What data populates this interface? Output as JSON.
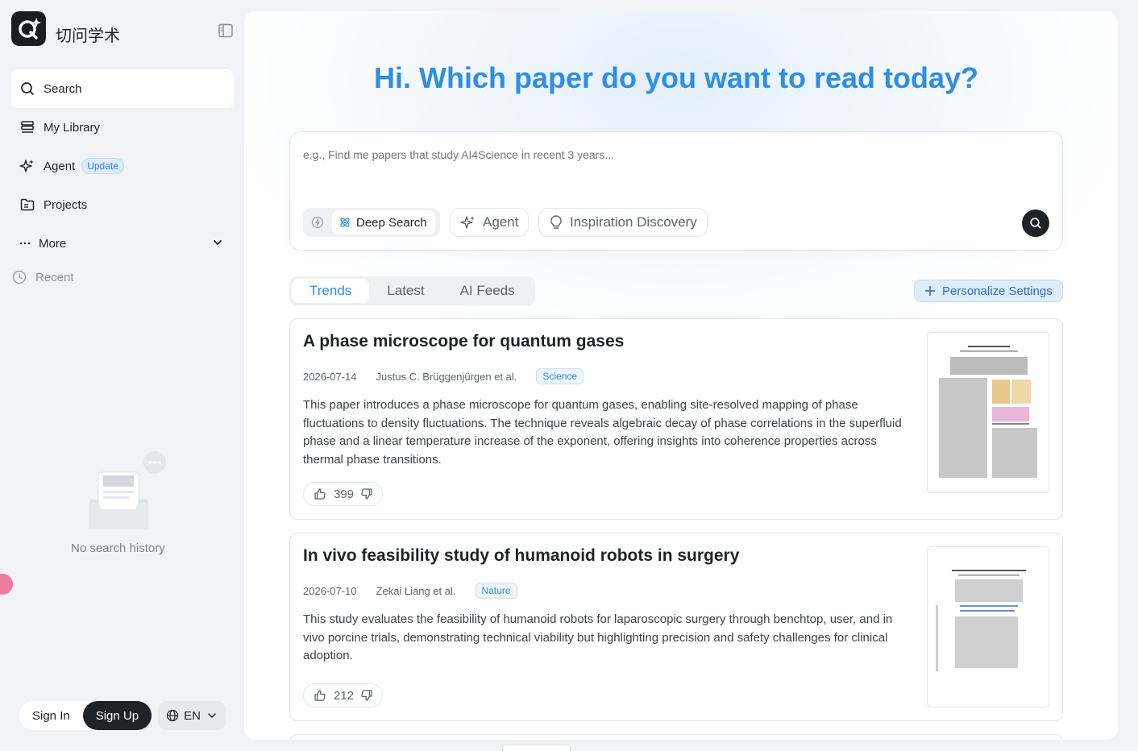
{
  "app": {
    "brand": "切问学术"
  },
  "sidebar": {
    "items": [
      {
        "label": "Search",
        "icon": "search-icon"
      },
      {
        "label": "My Library",
        "icon": "library-icon"
      },
      {
        "label": "Agent",
        "icon": "sparkle-icon",
        "badge": "Update"
      },
      {
        "label": "Projects",
        "icon": "folder-icon"
      },
      {
        "label": "More",
        "icon": "ellipsis-icon"
      }
    ],
    "recent_label": "Recent",
    "empty_text": "No search history"
  },
  "auth": {
    "sign_in": "Sign In",
    "sign_up": "Sign Up"
  },
  "language": {
    "current": "EN"
  },
  "hero": {
    "title": "Hi. Which paper do you want to read today?"
  },
  "search": {
    "placeholder": "e.g., Find me papers that study AI4Science in recent 3 years...",
    "modes": {
      "deep": "Deep Search",
      "agent": "Agent",
      "inspiration": "Inspiration Discovery"
    }
  },
  "feed": {
    "tabs": [
      "Trends",
      "Latest",
      "AI Feeds"
    ],
    "active_tab": "Trends",
    "personalize": "Personalize Settings"
  },
  "papers": [
    {
      "title": "A phase microscope for quantum gases",
      "date": "2026-07-14",
      "authors": "Justus C. Brüggenjürgen et al.",
      "venue": "Science",
      "abstract": "This paper introduces a phase microscope for quantum gases, enabling site-resolved mapping of phase fluctuations to density fluctuations. The technique reveals algebraic decay of phase correlations in the superfluid phase and a linear temperature increase of the exponent, offering insights into coherence properties across thermal phase transitions.",
      "likes": "399"
    },
    {
      "title": "In vivo feasibility study of humanoid robots in surgery",
      "date": "2026-07-10",
      "authors": "Zekai Liang et al.",
      "venue": "Nature",
      "abstract": "This study evaluates the feasibility of humanoid robots for laparoscopic surgery through benchtop, user, and in vivo porcine trials, demonstrating technical viability but highlighting precision and safety challenges for clinical adoption.",
      "likes": "212"
    }
  ],
  "colors": {
    "accent": "#2e8ee6",
    "dark": "#1f2329",
    "background": "#f1f3f7"
  }
}
